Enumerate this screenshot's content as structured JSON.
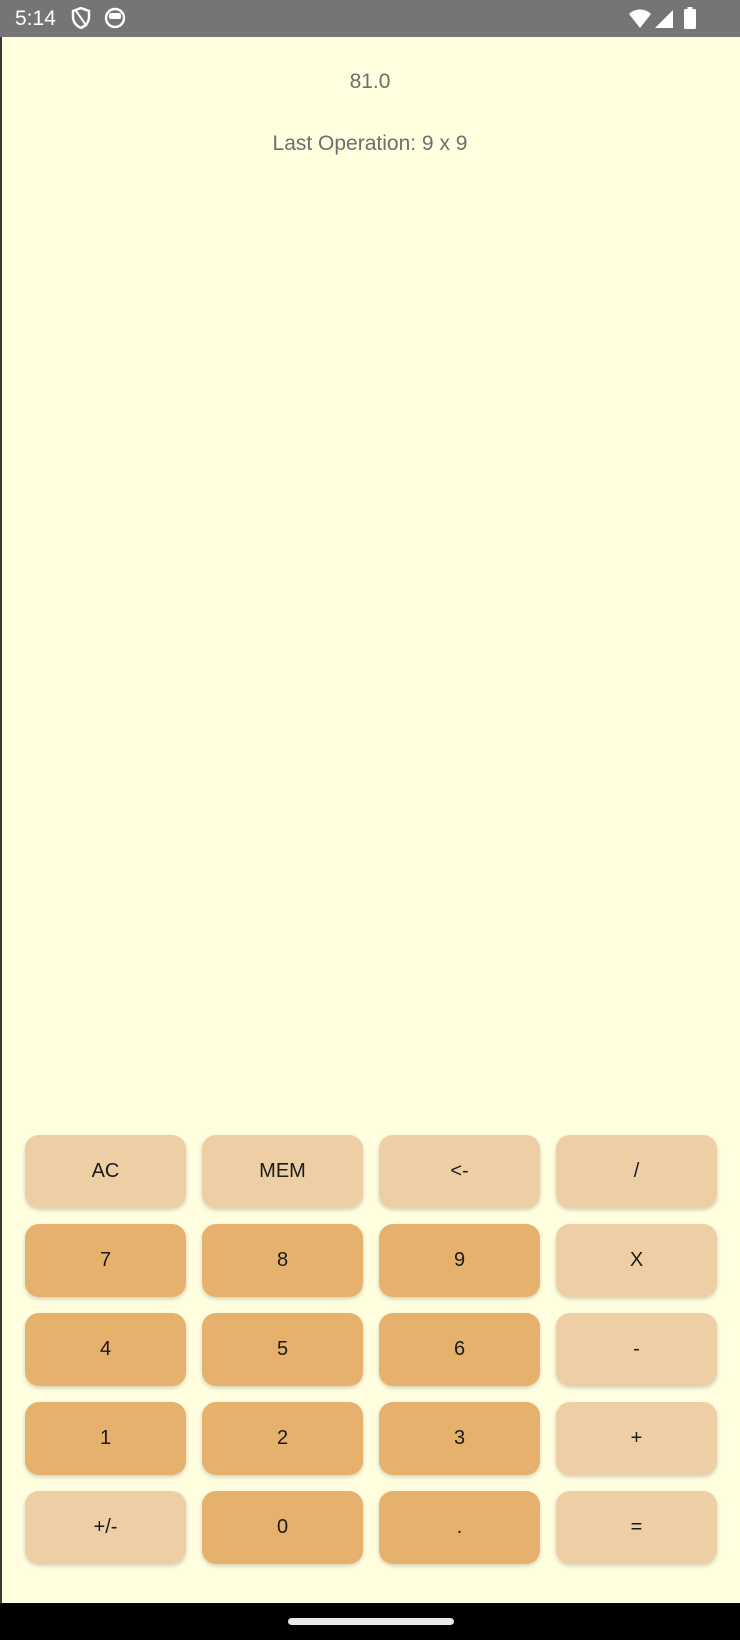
{
  "status_bar": {
    "time": "5:14",
    "icons": [
      "shield-icon",
      "face-icon",
      "wifi-icon",
      "signal-icon",
      "battery-icon"
    ]
  },
  "display": {
    "value": "81.0",
    "last_operation": "Last Operation: 9 x 9"
  },
  "keypad": {
    "keys": [
      {
        "label": "AC",
        "style": "light"
      },
      {
        "label": "MEM",
        "style": "light"
      },
      {
        "label": "<-",
        "style": "light"
      },
      {
        "label": "/",
        "style": "light"
      },
      {
        "label": "7",
        "style": "dark"
      },
      {
        "label": "8",
        "style": "dark"
      },
      {
        "label": "9",
        "style": "dark"
      },
      {
        "label": "X",
        "style": "light"
      },
      {
        "label": "4",
        "style": "dark"
      },
      {
        "label": "5",
        "style": "dark"
      },
      {
        "label": "6",
        "style": "dark"
      },
      {
        "label": "-",
        "style": "light"
      },
      {
        "label": "1",
        "style": "dark"
      },
      {
        "label": "2",
        "style": "dark"
      },
      {
        "label": "3",
        "style": "dark"
      },
      {
        "label": "+",
        "style": "light"
      },
      {
        "label": "+/-",
        "style": "light"
      },
      {
        "label": "0",
        "style": "dark"
      },
      {
        "label": ".",
        "style": "dark"
      },
      {
        "label": "=",
        "style": "light"
      }
    ]
  },
  "colors": {
    "background": "#FFFEDF",
    "key_light": "#EECFA5",
    "key_dark": "#E6B06D",
    "status_bar": "#757575",
    "text_muted": "#6e6e6e"
  }
}
